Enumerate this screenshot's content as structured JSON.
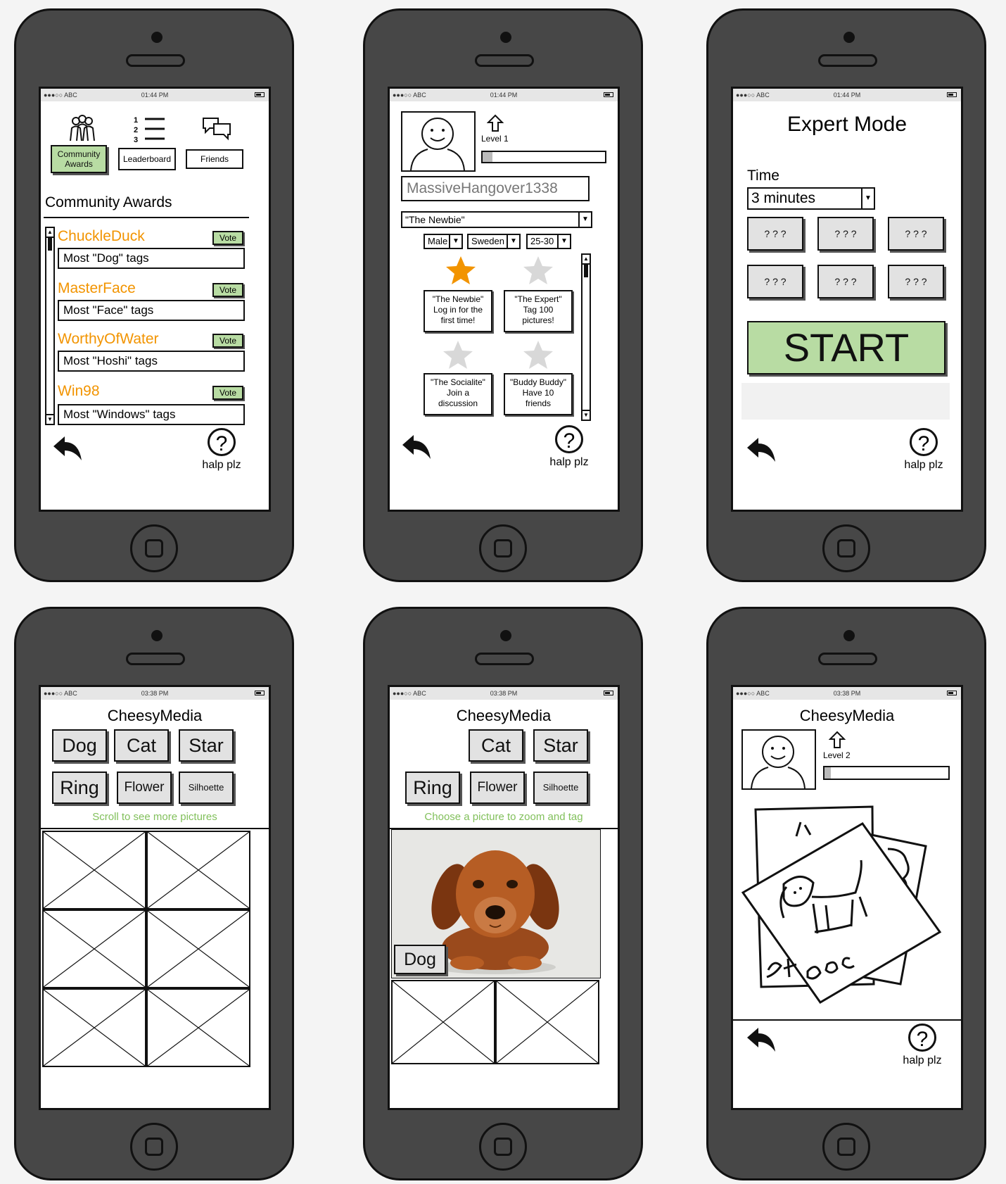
{
  "status_bar": {
    "carrier": "●●●○○ ABC",
    "time_am": "01:44 PM",
    "time_pm": "03:38 PM"
  },
  "help": {
    "label": "halp plz",
    "glyph": "?"
  },
  "screen1": {
    "tabs": [
      {
        "label": "Community Awards",
        "icon": "people-icon"
      },
      {
        "label": "Leaderboard",
        "icon": "ranked-list-icon"
      },
      {
        "label": "Friends",
        "icon": "chat-bubbles-icon"
      }
    ],
    "title": "Community Awards",
    "vote_label": "Vote",
    "awards": [
      {
        "name": "ChuckleDuck",
        "desc": "Most \"Dog\" tags"
      },
      {
        "name": "MasterFace",
        "desc": "Most \"Face\" tags"
      },
      {
        "name": "WorthyOfWater",
        "desc": "Most \"Hoshi\" tags"
      },
      {
        "name": "Win98",
        "desc": "Most \"Windows\" tags"
      }
    ]
  },
  "screen2": {
    "level": "Level 1",
    "level_progress": 0.08,
    "username": "MassiveHangover1338",
    "title_select": "\"The Newbie\"",
    "gender": "Male",
    "country": "Sweden",
    "age": "25-30",
    "achievements": [
      {
        "lines": [
          "\"The Newbie\"",
          "Log in for the",
          "first time!"
        ],
        "earned": true
      },
      {
        "lines": [
          "\"The Expert\"",
          "Tag 100",
          "pictures!"
        ],
        "earned": false
      },
      {
        "lines": [
          "\"The Socialite\"",
          "Join a",
          "discussion"
        ],
        "earned": false
      },
      {
        "lines": [
          "\"Buddy Buddy\"",
          "Have 10",
          "friends"
        ],
        "earned": false
      }
    ]
  },
  "screen3": {
    "title": "Expert Mode",
    "time_label": "Time",
    "time_value": "3 minutes",
    "slots": [
      "? ? ?",
      "? ? ?",
      "? ? ?",
      "? ? ?",
      "? ? ?",
      "? ? ?"
    ],
    "start": "START"
  },
  "screen4": {
    "app": "CheesyMedia",
    "tags_row1": [
      "Dog",
      "Cat",
      "Star"
    ],
    "tags_row2": [
      "Ring",
      "Flower",
      "Silhoette"
    ],
    "hint": "Scroll to see more pictures"
  },
  "screen5": {
    "app": "CheesyMedia",
    "tags_row1": [
      "Cat",
      "Star"
    ],
    "tags_row2": [
      "Ring",
      "Flower",
      "Silhoette"
    ],
    "hint": "Choose a picture to zoom and tag",
    "dragged_tag": "Dog"
  },
  "screen6": {
    "app": "CheesyMedia",
    "level": "Level 2",
    "level_progress": 0.05
  }
}
